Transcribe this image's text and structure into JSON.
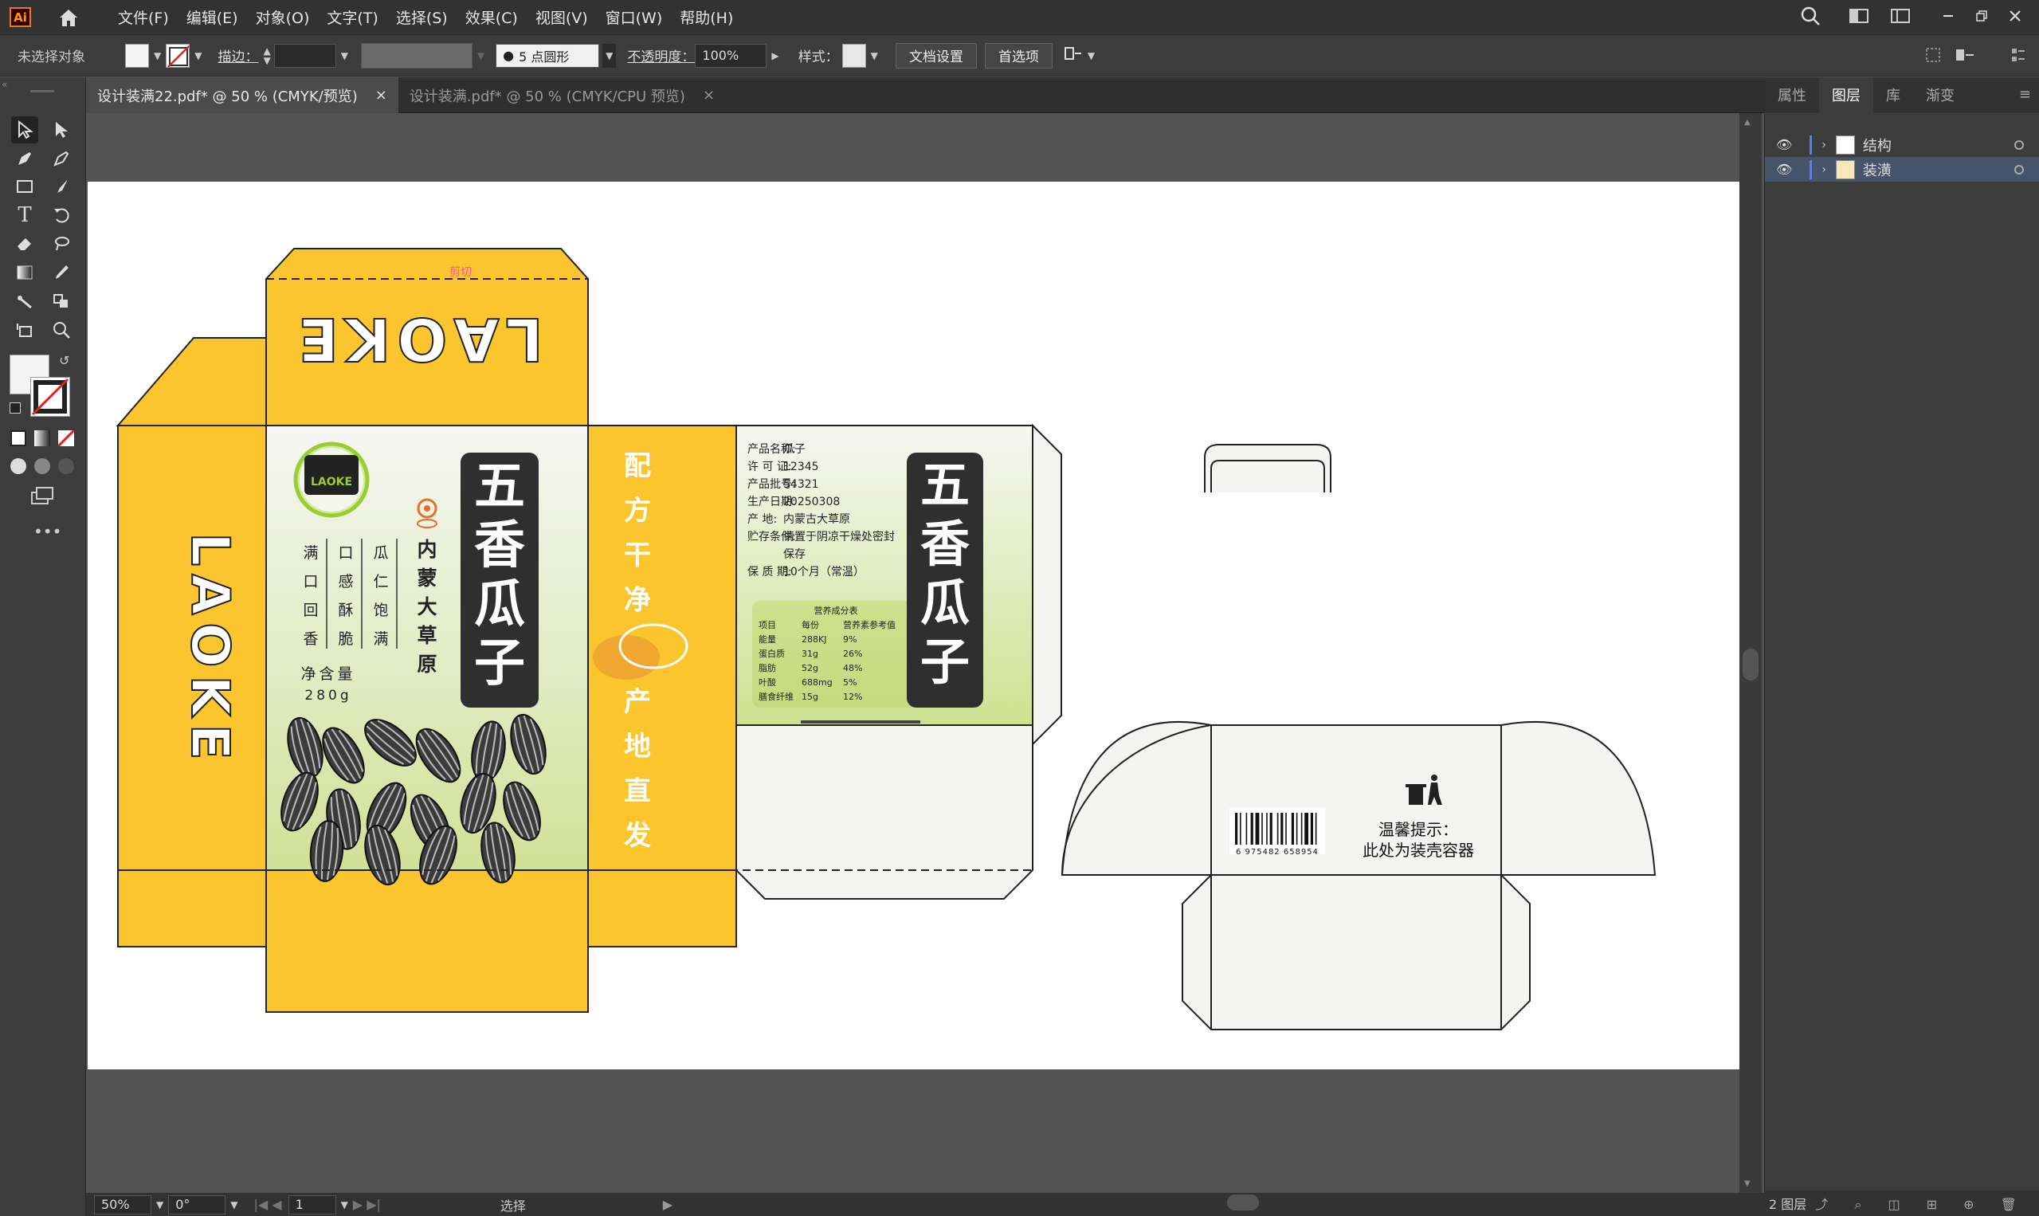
{
  "app": {
    "logo": "Ai"
  },
  "menus": [
    "文件(F)",
    "编辑(E)",
    "对象(O)",
    "文字(T)",
    "选择(S)",
    "效果(C)",
    "视图(V)",
    "窗口(W)",
    "帮助(H)"
  ],
  "control": {
    "selection": "未选择对象",
    "stroke_label": "描边：",
    "brush": "5 点圆形",
    "opacity_label": "不透明度：",
    "opacity": "100%",
    "style_label": "样式：",
    "doc_setup": "文档设置",
    "prefs": "首选项"
  },
  "tabs": [
    {
      "label": "设计装满22.pdf* @ 50 % (CMYK/预览)",
      "close": "×"
    },
    {
      "label": "设计装满.pdf* @ 50 % (CMYK/CPU 预览)",
      "close": "×"
    }
  ],
  "panel": {
    "tabs": [
      "属性",
      "图层",
      "库",
      "渐变"
    ],
    "layers": [
      "结构",
      "装潢"
    ],
    "count": "2 图层"
  },
  "status": {
    "zoom": "50%",
    "rotate": "0°",
    "page": "1",
    "tool": "选择"
  },
  "design": {
    "brand": "LAOKE",
    "logo_text": "LAOKE",
    "pink_label": "剪切",
    "product_title": [
      "五",
      "香",
      "瓜",
      "子"
    ],
    "origin": [
      "内",
      "蒙",
      "大",
      "草",
      "原"
    ],
    "col1": [
      "满",
      "口",
      "回",
      "香"
    ],
    "col2": [
      "口",
      "感",
      "酥",
      "脆"
    ],
    "col3": [
      "瓜",
      "仁",
      "饱",
      "满"
    ],
    "net_label": "净含量",
    "net_value": "280g",
    "side_slogan1": [
      "配",
      "方",
      "干",
      "净"
    ],
    "side_slogan2": [
      "产",
      "地",
      "直",
      "发"
    ],
    "info": [
      {
        "k": "产品名称:",
        "v": "瓜子"
      },
      {
        "k": "许 可 证:",
        "v": "12345"
      },
      {
        "k": "产品批号:",
        "v": "54321"
      },
      {
        "k": "生产日期:",
        "v": "20250308"
      },
      {
        "k": "产    地:",
        "v": "内蒙古大草原"
      },
      {
        "k": "贮存条件:",
        "v": "请置于阴凉干燥处密封"
      },
      {
        "k": "",
        "v": "保存"
      },
      {
        "k": "保 质 期:",
        "v": "10个月（常温）"
      }
    ],
    "nutrition": {
      "title": "营养成分表",
      "headers": [
        "项目",
        "每份",
        "营养素参考值"
      ],
      "rows": [
        [
          "能量",
          "288KJ",
          "9%"
        ],
        [
          "蛋白质",
          "31g",
          "26%"
        ],
        [
          "脂肪",
          "52g",
          "48%"
        ],
        [
          "叶酸",
          "688mg",
          "5%"
        ],
        [
          "膳食纤维",
          "15g",
          "12%"
        ]
      ]
    },
    "barcode": "6 975482 658954",
    "tip1": "温馨提示：",
    "tip2": "此处为装壳容器"
  },
  "colors": {
    "yellow": "#fbc52e",
    "dark": "#2f2f2f",
    "green": "#d4e39a"
  }
}
